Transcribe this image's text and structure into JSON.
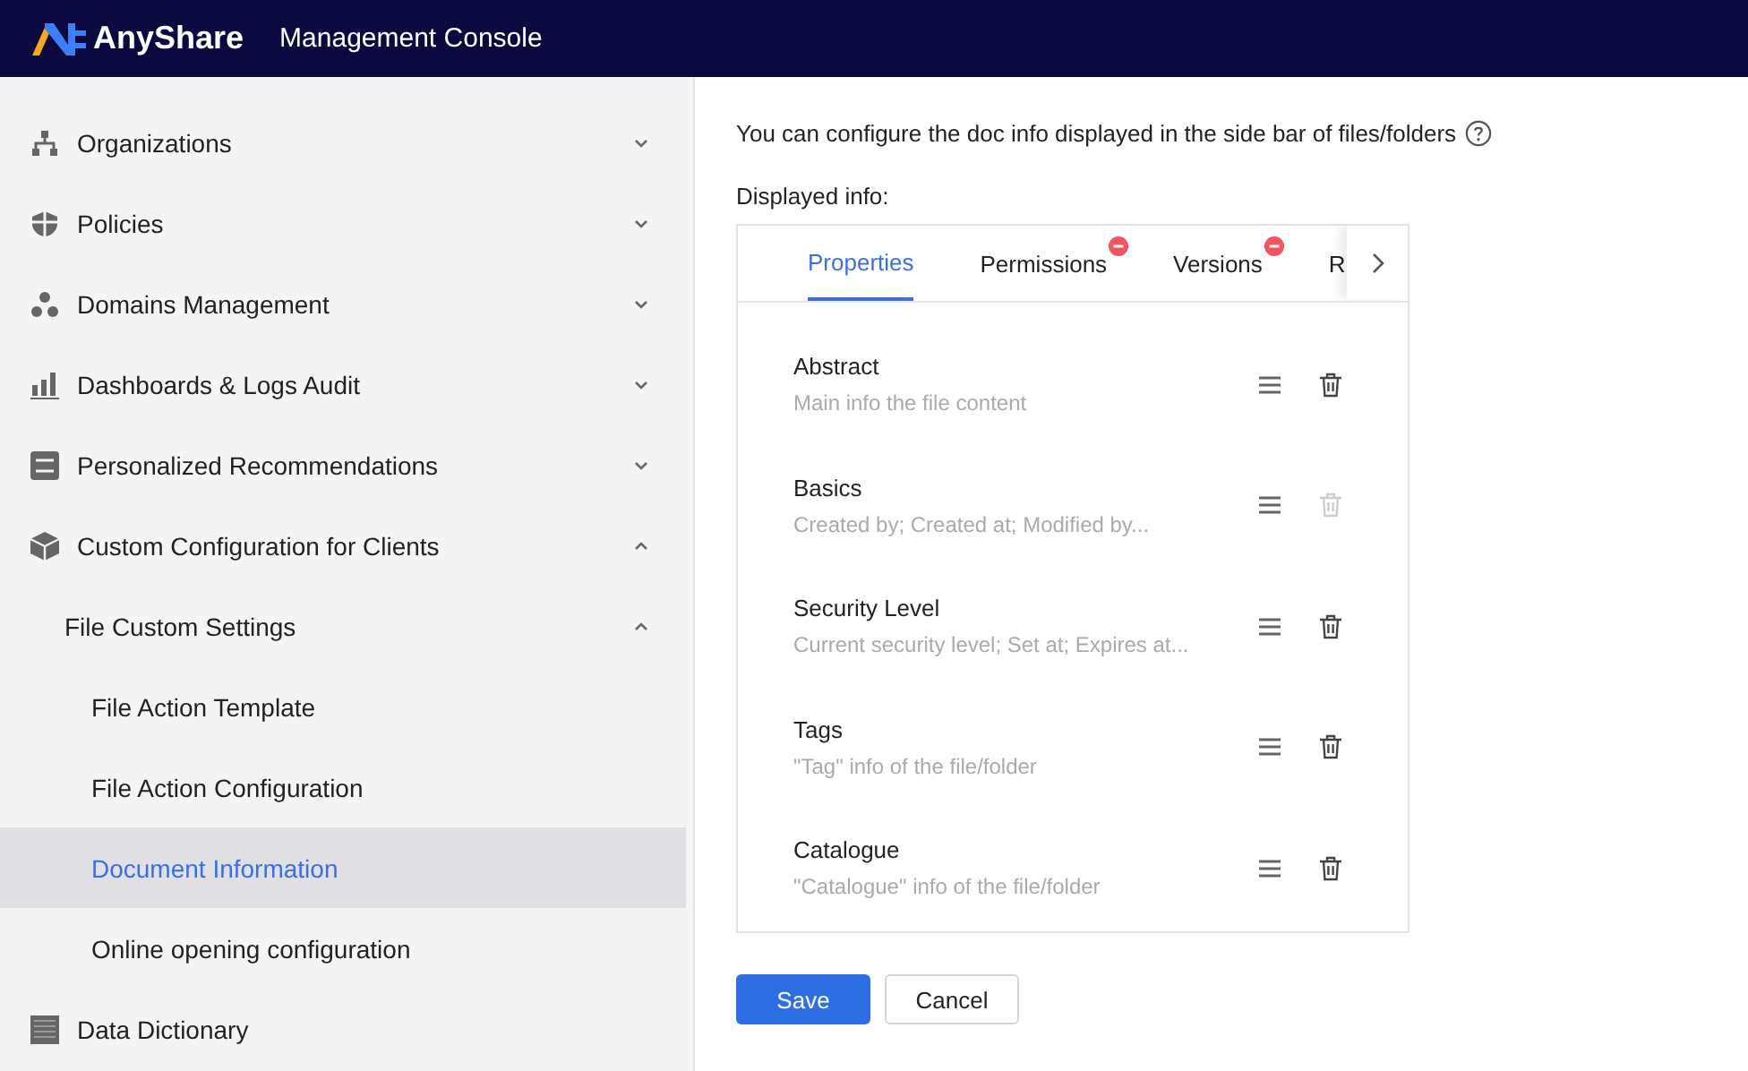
{
  "header": {
    "brand": "AnyShare",
    "title": "Management Console"
  },
  "sidebar": {
    "items": [
      {
        "label": "Organizations",
        "kind": "org",
        "expanded": false
      },
      {
        "label": "Policies",
        "kind": "shield",
        "expanded": false
      },
      {
        "label": "Domains Management",
        "kind": "dots",
        "expanded": false
      },
      {
        "label": "Dashboards & Logs Audit",
        "kind": "bars",
        "expanded": false
      },
      {
        "label": "Personalized Recommendations",
        "kind": "sliders",
        "expanded": false
      },
      {
        "label": "Custom Configuration for Clients",
        "kind": "cube",
        "expanded": true,
        "children": [
          {
            "label": "File Custom Settings",
            "expanded": true,
            "children": [
              {
                "label": "File Action Template",
                "selected": false
              },
              {
                "label": "File Action Configuration",
                "selected": false
              },
              {
                "label": "Document Information",
                "selected": true
              },
              {
                "label": "Online opening configuration",
                "selected": false
              }
            ]
          }
        ]
      },
      {
        "label": "Data Dictionary",
        "kind": "book"
      }
    ]
  },
  "main": {
    "intro": "You can configure the doc info displayed in the side bar of files/folders",
    "displayed_label": "Displayed info:",
    "tabs": [
      {
        "label": "Properties",
        "selected": true,
        "removable": false
      },
      {
        "label": "Permissions",
        "selected": false,
        "removable": true
      },
      {
        "label": "Versions",
        "selected": false,
        "removable": true
      },
      {
        "label": "R",
        "selected": false,
        "removable": false
      }
    ],
    "rows": [
      {
        "title": "Abstract",
        "description": "Main info the file content",
        "delete_disabled": false
      },
      {
        "title": "Basics",
        "description": "Created by; Created at; Modified by...",
        "delete_disabled": true
      },
      {
        "title": "Security Level",
        "description": "Current security level; Set at; Expires at...",
        "delete_disabled": false
      },
      {
        "title": "Tags",
        "description": "\"Tag\" info of the file/folder",
        "delete_disabled": false
      },
      {
        "title": "Catalogue",
        "description": "\"Catalogue\" info of the file/folder",
        "delete_disabled": false
      }
    ],
    "buttons": [
      {
        "label": "Save",
        "kind": "primary"
      },
      {
        "label": "Cancel",
        "kind": "default"
      }
    ]
  }
}
